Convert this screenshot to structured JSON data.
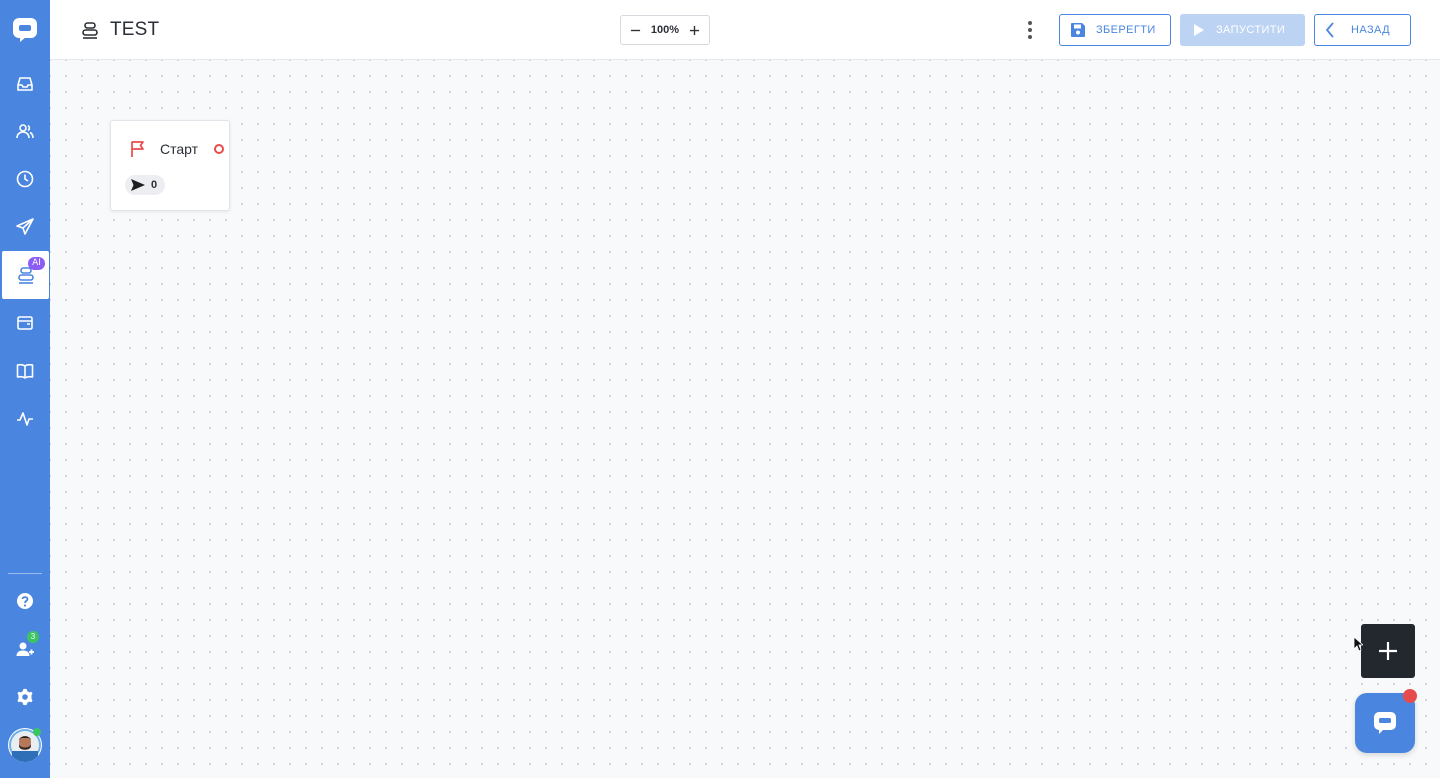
{
  "sidebar": {
    "items": [
      {
        "name": "inbox-icon"
      },
      {
        "name": "contacts-icon"
      },
      {
        "name": "history-icon"
      },
      {
        "name": "broadcast-icon"
      },
      {
        "name": "bot-builder-icon",
        "badge": "AI",
        "active": true
      },
      {
        "name": "wallet-icon"
      },
      {
        "name": "knowledge-base-icon"
      },
      {
        "name": "analytics-icon"
      }
    ],
    "bottom": [
      {
        "name": "help-icon"
      },
      {
        "name": "team-icon",
        "badge": "3"
      },
      {
        "name": "settings-icon"
      }
    ]
  },
  "header": {
    "title": "TEST",
    "zoom": "100%",
    "save_label": "ЗБЕРЕГТИ",
    "run_label": "ЗАПУСТИТИ",
    "back_label": "НАЗАД"
  },
  "canvas": {
    "node": {
      "title": "Старт",
      "icon": "flag-icon",
      "sent_count": "0"
    }
  },
  "colors": {
    "sidebar": "#4a86e0",
    "accent": "#4a86e0",
    "run_disabled": "#bcd3f4",
    "port": "#e74c4c",
    "ai_badge": "#8b5cf6",
    "online": "#3cc463"
  }
}
